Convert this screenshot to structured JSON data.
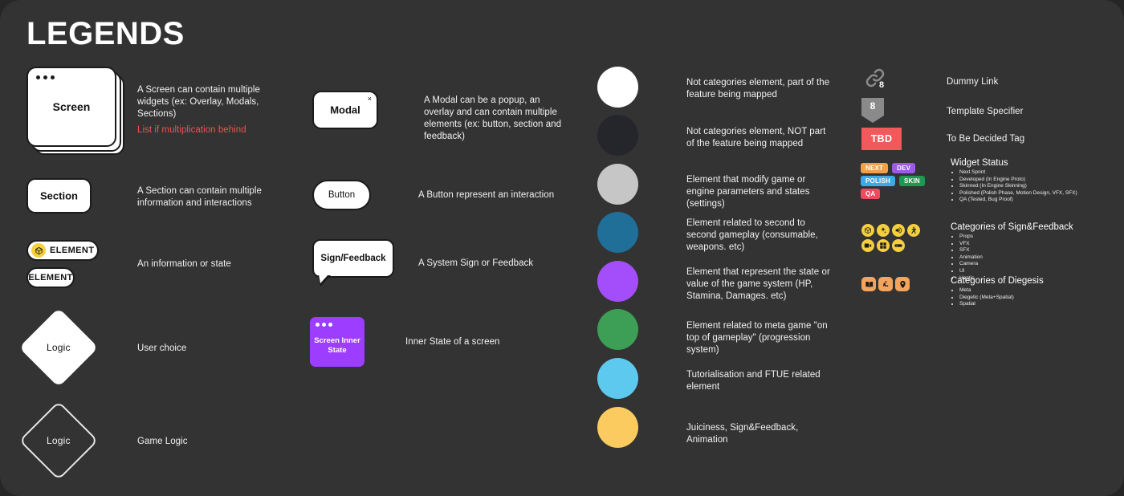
{
  "page": {
    "title": "LEGENDS",
    "background": "#333333"
  },
  "shapes": {
    "screen": {
      "label": "Screen",
      "description": "A Screen can contain multiple widgets (ex: Overlay, Modals, Sections)",
      "note": "List if multiplication behind",
      "note_color": "#e8564f"
    },
    "section": {
      "label": "Section",
      "description": "A Section can contain multiple information and interactions"
    },
    "element": {
      "label_badged": "ELEMENT",
      "label_plain": "ELEMENT",
      "badge_icon": "cube-icon",
      "badge_color": "#f5cf3d",
      "description": "An information or state"
    },
    "logic_user": {
      "label": "Logic",
      "description": "User choice"
    },
    "logic_game": {
      "label": "Logic",
      "description": "Game Logic"
    },
    "modal": {
      "label": "Modal",
      "close_icon": "close-icon",
      "close_glyph": "×",
      "description": "A Modal can be a popup, an overlay and can contain multiple elements (ex: button, section and feedback)"
    },
    "button": {
      "label": "Button",
      "description": "A Button represent an interaction"
    },
    "sign_feedback": {
      "label": "Sign/Feedback",
      "description": "A System Sign or Feedback"
    },
    "screen_inner_state": {
      "label": "Screen Inner State",
      "color": "#9d3dff",
      "description": "Inner State of a screen"
    }
  },
  "swatches": [
    {
      "name": "white",
      "color": "#ffffff",
      "description": "Not categories element, part of the feature being mapped"
    },
    {
      "name": "near-black",
      "color": "#24262b",
      "description": "Not categories element, NOT part of the feature being mapped"
    },
    {
      "name": "grey",
      "color": "#c6c6c6",
      "description": "Element that modify game or engine parameters and states (settings)"
    },
    {
      "name": "blue",
      "color": "#1f6f99",
      "description": "Element related to second to second gameplay (consumable, weapons. etc)"
    },
    {
      "name": "purple",
      "color": "#a44dfb",
      "description": "Element that represent the state or value of the game system (HP, Stamina, Damages. etc)"
    },
    {
      "name": "green",
      "color": "#3d9e56",
      "description": "Element related to meta game \"on top of gameplay\" (progression system)"
    },
    {
      "name": "cyan",
      "color": "#5ec9ee",
      "description": "Tutorialisation and FTUE related element"
    },
    {
      "name": "yellow",
      "color": "#fbcb5f",
      "description": "Juiciness, Sign&Feedback, Animation"
    }
  ],
  "markers": {
    "dummy_link": {
      "icon": "link-icon",
      "count": "8",
      "description": "Dummy Link"
    },
    "template_specifier": {
      "icon": "pin-icon",
      "count": "8",
      "color": "#8a8a8a",
      "description": "Template Specifier"
    },
    "tbd": {
      "label": "TBD",
      "color": "#f2595b",
      "description": "To Be Decided Tag"
    }
  },
  "widget_status": {
    "title": "Widget Status",
    "tags": [
      {
        "label": "NEXT",
        "color": "#f0a14b"
      },
      {
        "label": "DEV",
        "color": "#9d59e8"
      },
      {
        "label": "POLISH",
        "color": "#3fa8e8"
      },
      {
        "label": "SKIN",
        "color": "#239652"
      },
      {
        "label": "QA",
        "color": "#ef4a5e"
      }
    ],
    "items": [
      "Next Sprint",
      "Developed (In Engine Proto)",
      "Skinned (In Engine Skinning)",
      "Polished (Polish Phase, Motion Design, VFX, SFX)",
      "QA (Tested, Bug Proof)"
    ]
  },
  "sign_feedback_categories": {
    "title": "Categories of Sign&Feedback",
    "icon_color": "#f5cf3d",
    "icons": [
      "cube-icon",
      "sparkle-icon",
      "speaker-icon",
      "run-icon",
      "camera-icon",
      "grid-icon",
      "haptic-icon"
    ],
    "items": [
      "Props",
      "VFX",
      "SFX",
      "Animation",
      "Camera",
      "UI",
      "Haptic"
    ]
  },
  "diegesis_categories": {
    "title": "Categories of Diegesis",
    "icon_color": "#f5a45c",
    "icons": [
      "book-icon",
      "flag-icon",
      "location-pin-icon"
    ],
    "items": [
      "Meta",
      "Diegetic (Meta+Spatial)",
      "Spatial"
    ]
  }
}
